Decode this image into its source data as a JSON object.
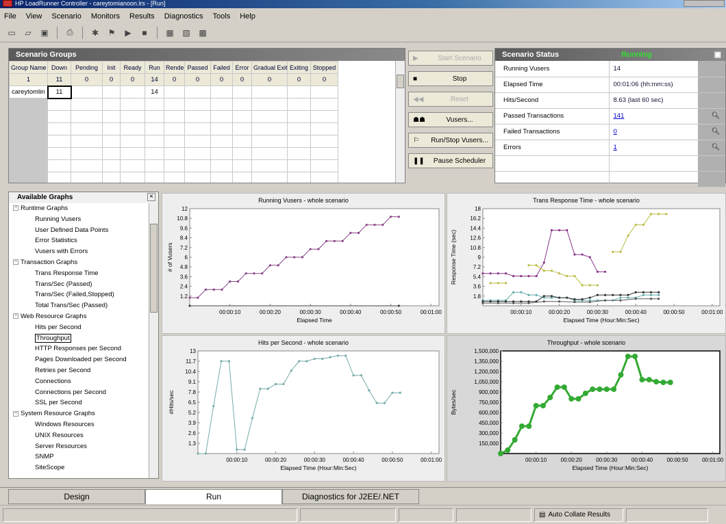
{
  "window": {
    "title": "HP LoadRunner Controller - careytomianoon.lrs - [Run]"
  },
  "menu": [
    "File",
    "View",
    "Scenario",
    "Monitors",
    "Results",
    "Diagnostics",
    "Tools",
    "Help"
  ],
  "toolbar": [
    "new-icon",
    "open-icon",
    "save-icon",
    "print-icon",
    "scenario-icon",
    "vuser-icon",
    "run-icon",
    "stop-icon",
    "results-icon",
    "analysis-icon",
    "monitor-icon"
  ],
  "scenario_groups": {
    "title": "Scenario Groups",
    "columns": [
      "Group Name",
      "Down",
      "Pending",
      "Init",
      "Ready",
      "Run",
      "Rendez",
      "Passed",
      "Failed",
      "Error",
      "Gradual Exiting",
      "Exiting",
      "Stopped"
    ],
    "counts": [
      "1",
      "11",
      "0",
      "0",
      "0",
      "14",
      "0",
      "0",
      "0",
      "0",
      "0",
      "0",
      "0"
    ],
    "rows": [
      [
        "careytomlin",
        "11",
        "",
        "",
        "",
        "14",
        "",
        "",
        "",
        "",
        "",
        "",
        ""
      ]
    ]
  },
  "controls": [
    {
      "icon": "play-icon",
      "label": "Start Scenario",
      "enabled": false
    },
    {
      "icon": "stop-icon",
      "label": "Stop",
      "enabled": true
    },
    {
      "icon": "reset-icon",
      "label": "Reset",
      "enabled": false
    },
    {
      "icon": "vusers-icon",
      "label": "Vusers...",
      "enabled": true
    },
    {
      "icon": "run-stop-vusers-icon",
      "label": "Run/Stop Vusers...",
      "enabled": true
    },
    {
      "icon": "pause-icon",
      "label": "Pause Scheduler",
      "enabled": true
    }
  ],
  "scenario_status": {
    "title": "Scenario Status",
    "state": "Running",
    "rows": [
      {
        "label": "Running Vusers",
        "value": "14",
        "link": false,
        "magnifier": false
      },
      {
        "label": "Elapsed Time",
        "value": "00:01:06 (hh:mm:ss)",
        "link": false,
        "magnifier": false
      },
      {
        "label": "Hits/Second",
        "value": "8.63 (last 60 sec)",
        "link": false,
        "magnifier": false
      },
      {
        "label": "Passed Transactions",
        "value": "141",
        "link": true,
        "magnifier": true
      },
      {
        "label": "Failed Transactions",
        "value": "0",
        "link": true,
        "magnifier": true
      },
      {
        "label": "Errors",
        "value": "1",
        "link": true,
        "magnifier": true
      }
    ]
  },
  "available_graphs": {
    "title": "Available Graphs",
    "close": "×",
    "tree": [
      {
        "type": "cat",
        "label": "Runtime Graphs"
      },
      {
        "type": "item",
        "label": "Running Vusers"
      },
      {
        "type": "item",
        "label": "User Defined Data Points"
      },
      {
        "type": "item",
        "label": "Error Statistics"
      },
      {
        "type": "item",
        "label": "Vusers with Errors"
      },
      {
        "type": "cat",
        "label": "Transaction Graphs"
      },
      {
        "type": "item",
        "label": "Trans Response Time"
      },
      {
        "type": "item",
        "label": "Trans/Sec (Passed)"
      },
      {
        "type": "item",
        "label": "Trans/Sec (Failed,Stopped)"
      },
      {
        "type": "item",
        "label": "Total Trans/Sec (Passed)"
      },
      {
        "type": "cat",
        "label": "Web Resource Graphs"
      },
      {
        "type": "item",
        "label": "Hits per Second"
      },
      {
        "type": "item",
        "label": "Throughput",
        "selected": true
      },
      {
        "type": "item",
        "label": "HTTP Responses per Second"
      },
      {
        "type": "item",
        "label": "Pages Downloaded per Second"
      },
      {
        "type": "item",
        "label": "Retries per Second"
      },
      {
        "type": "item",
        "label": "Connections"
      },
      {
        "type": "item",
        "label": "Connections per Second"
      },
      {
        "type": "item",
        "label": "SSL per Second"
      },
      {
        "type": "cat",
        "label": "System Resource Graphs"
      },
      {
        "type": "item",
        "label": "Windows Resources"
      },
      {
        "type": "item",
        "label": "UNIX Resources"
      },
      {
        "type": "item",
        "label": "Server Resources"
      },
      {
        "type": "item",
        "label": "SNMP"
      },
      {
        "type": "item",
        "label": "SiteScope"
      }
    ]
  },
  "chart_data": [
    {
      "type": "line",
      "title": "Running Vusers - whole scenario",
      "xlabel": "Elapsed Time",
      "ylabel": "# of Vusers",
      "ylim": [
        0,
        12
      ],
      "yticks": [
        "12",
        "10.8",
        "9.6",
        "8.4",
        "7.2",
        "6",
        "4.8",
        "3.6",
        "2.4",
        "1.2"
      ],
      "xticks": [
        "00:00:10",
        "00:00:20",
        "00:00:30",
        "00:00:40",
        "00:00:50",
        "00:01:00"
      ],
      "series": [
        {
          "color": "#884488",
          "x": [
            0,
            2,
            4,
            6,
            8,
            10,
            12,
            14,
            16,
            18,
            20,
            22,
            24,
            26,
            28,
            30,
            32,
            34,
            36,
            38,
            40,
            42,
            44,
            46,
            48,
            50,
            52
          ],
          "values": [
            1,
            1,
            2,
            2,
            2,
            3,
            3,
            4,
            4,
            4,
            5,
            5,
            6,
            6,
            6,
            7,
            7,
            8,
            8,
            8,
            9,
            9,
            10,
            10,
            10,
            11,
            11
          ]
        },
        {
          "color": "#444444",
          "x": [
            0,
            52
          ],
          "values": [
            0,
            0
          ]
        }
      ]
    },
    {
      "type": "line",
      "title": "Trans Response Time - whole scenario",
      "xlabel": "Elapsed Time (Hour:Min:Sec)",
      "ylabel": "Response Time (sec)",
      "ylim": [
        0,
        18
      ],
      "yticks": [
        "18",
        "16.2",
        "14.4",
        "12.6",
        "10.8",
        "9",
        "7.2",
        "5.4",
        "3.6",
        "1.8"
      ],
      "xticks": [
        "00:00:10",
        "00:00:20",
        "00:00:30",
        "00:00:40",
        "00:00:50",
        "00:01:00"
      ],
      "series": [
        {
          "color": "#883388",
          "x": [
            0,
            2,
            4,
            6,
            8,
            10,
            12,
            14,
            16,
            18,
            20,
            22,
            24,
            26,
            28,
            30,
            32
          ],
          "values": [
            6,
            6,
            6,
            6,
            5.5,
            5.5,
            5.5,
            5.5,
            8,
            14,
            14,
            14,
            9.5,
            9.5,
            9,
            6.3,
            6.3
          ]
        },
        {
          "color": "#bbbb44",
          "x": [
            2,
            4,
            6,
            8,
            10,
            12,
            14,
            16,
            18,
            20,
            22,
            24,
            26,
            28,
            30,
            32,
            34,
            36,
            38,
            40,
            42,
            44,
            46,
            48
          ],
          "values": [
            4.2,
            4.2,
            4.2,
            null,
            null,
            7.5,
            7.5,
            6.5,
            6.5,
            6,
            5.5,
            5.5,
            3.8,
            3.8,
            3.8,
            null,
            10,
            10,
            13,
            15,
            15,
            17,
            17,
            17
          ]
        },
        {
          "color": "#66aaaa",
          "x": [
            0,
            2,
            4,
            6,
            8,
            10,
            12,
            14,
            16,
            18,
            20,
            22,
            24,
            26,
            28,
            30,
            32,
            34,
            36,
            38,
            40,
            42,
            44,
            46
          ],
          "values": [
            1,
            1,
            1,
            1,
            2.5,
            2.5,
            2,
            2,
            1.5,
            1.5,
            1.5,
            1.5,
            1,
            1,
            1,
            1,
            1,
            1,
            1.5,
            1.5,
            1.5,
            2,
            2,
            2
          ]
        },
        {
          "color": "#333333",
          "x": [
            0,
            2,
            4,
            6,
            8,
            10,
            12,
            14,
            16,
            18,
            20,
            22,
            24,
            26,
            28,
            30,
            32,
            34,
            36,
            38,
            40,
            42,
            44,
            46
          ],
          "values": [
            0.8,
            0.8,
            0.8,
            0.8,
            0.8,
            0.8,
            0.8,
            0.8,
            1.8,
            1.8,
            1.5,
            1.5,
            1.2,
            1.2,
            1.5,
            2,
            2,
            2,
            2,
            2,
            2.5,
            2.5,
            2.5,
            2.5
          ]
        },
        {
          "color": "#555555",
          "x": [
            0,
            4,
            8,
            12,
            16,
            20,
            24,
            28,
            32,
            36,
            40,
            44,
            46
          ],
          "values": [
            0.5,
            0.5,
            0.5,
            0.5,
            0.8,
            0.8,
            0.7,
            0.7,
            1,
            1,
            1.3,
            1.3,
            1.3
          ]
        }
      ]
    },
    {
      "type": "line",
      "title": "Hits per Second - whole scenario",
      "xlabel": "Elapsed Time (Hour:Min:Sec)",
      "ylabel": "#Hits/sec",
      "ylim": [
        0,
        13
      ],
      "yticks": [
        "13",
        "11.7",
        "10.4",
        "9.1",
        "7.8",
        "6.5",
        "5.2",
        "3.9",
        "2.6",
        "1.3"
      ],
      "xticks": [
        "00:00:10",
        "00:00:20",
        "00:00:30",
        "00:00:40",
        "00:00:50",
        "00:01:00"
      ],
      "series": [
        {
          "color": "#77aaaa",
          "x": [
            0,
            2,
            4,
            6,
            8,
            10,
            12,
            14,
            16,
            18,
            20,
            22,
            24,
            26,
            28,
            30,
            32,
            34,
            36,
            38,
            40,
            42,
            44,
            46,
            48,
            50,
            52
          ],
          "values": [
            0,
            0,
            6,
            11.7,
            11.7,
            0.5,
            0.5,
            4.5,
            8.2,
            8.2,
            8.8,
            8.8,
            10.5,
            11.7,
            11.7,
            12,
            12,
            12.2,
            12.4,
            12.4,
            9.9,
            9.9,
            8,
            6.4,
            6.4,
            7.7,
            7.7
          ]
        }
      ]
    },
    {
      "type": "line",
      "title": "Throughput - whole scenario",
      "xlabel": "Elapsed Time (Hour:Min:Sec)",
      "ylabel": "Bytes/sec",
      "ylim": [
        0,
        1500000
      ],
      "yticks": [
        "1,500,000",
        "1,350,000",
        "1,200,000",
        "1,050,000",
        "900,000",
        "750,000",
        "600,000",
        "450,000",
        "300,000",
        "150,000"
      ],
      "xticks": [
        "00:00:10",
        "00:00:20",
        "00:00:30",
        "00:00:40",
        "00:00:50",
        "00:01:00"
      ],
      "series": [
        {
          "color": "#33aa33",
          "x": [
            0,
            2,
            4,
            6,
            8,
            10,
            12,
            14,
            16,
            18,
            20,
            22,
            24,
            26,
            28,
            30,
            32,
            34,
            36,
            38,
            40,
            42,
            44,
            46,
            48
          ],
          "values": [
            0,
            50000,
            200000,
            400000,
            400000,
            700000,
            700000,
            820000,
            970000,
            970000,
            800000,
            800000,
            880000,
            940000,
            940000,
            940000,
            940000,
            1150000,
            1420000,
            1420000,
            1080000,
            1080000,
            1050000,
            1040000,
            1040000
          ]
        }
      ]
    }
  ],
  "tabs": [
    {
      "label": "Design",
      "active": false
    },
    {
      "label": "Run",
      "active": true
    },
    {
      "label": "Diagnostics for J2EE/.NET",
      "active": false
    }
  ],
  "statusbar": {
    "auto_collate": "Auto Collate Results"
  }
}
